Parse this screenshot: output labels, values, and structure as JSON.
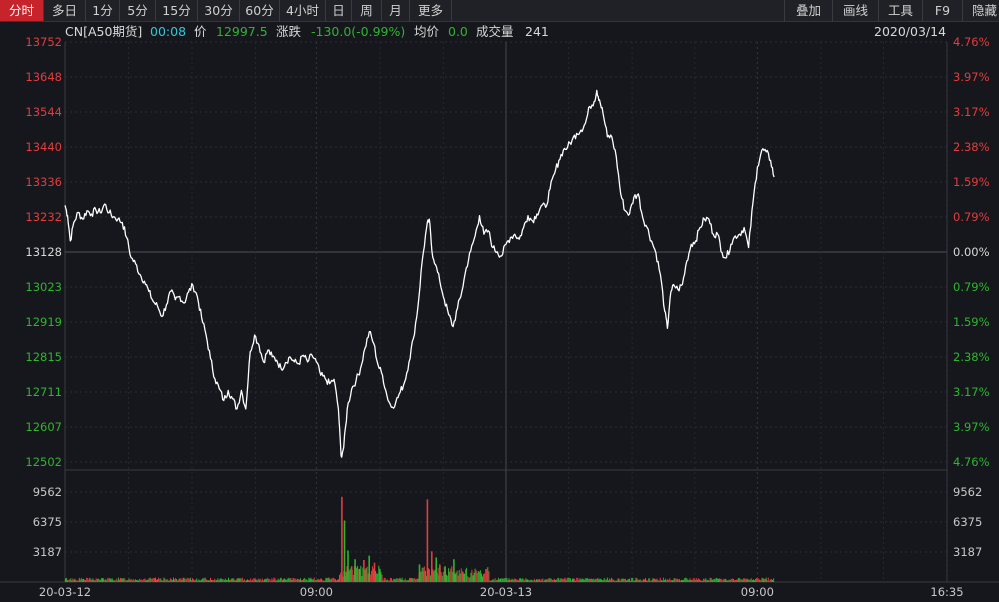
{
  "toolbar": {
    "tabs": [
      {
        "label": "分时",
        "active": true
      },
      {
        "label": "多日",
        "active": false
      },
      {
        "label": "1分",
        "active": false
      },
      {
        "label": "5分",
        "active": false
      },
      {
        "label": "15分",
        "active": false
      },
      {
        "label": "30分",
        "active": false
      },
      {
        "label": "60分",
        "active": false
      },
      {
        "label": "4小时",
        "active": false
      },
      {
        "label": "日",
        "active": false
      },
      {
        "label": "周",
        "active": false
      },
      {
        "label": "月",
        "active": false
      },
      {
        "label": "更多",
        "active": false
      }
    ],
    "right": [
      "叠加",
      "画线",
      "工具",
      "F9",
      "隐藏"
    ]
  },
  "info": {
    "symbol": "CN[A50期货]",
    "time": "00:08",
    "price_label": "价",
    "price": "12997.5",
    "change_label": "涨跌",
    "change": "-130.0(-0.99%)",
    "avg_label": "均价",
    "avg": "0.0",
    "volume_label": "成交量",
    "volume": "241",
    "date": "2020/03/14"
  },
  "colors": {
    "up": "#e23c3c",
    "down": "#2fb42f",
    "line": "#ffffff",
    "grid": "#2c2d33",
    "neutral": "#d8d8d8",
    "cyan": "#30c8d8"
  },
  "chart_data": {
    "type": "line",
    "y_ticks": [
      13752,
      13648,
      13544,
      13440,
      13336,
      13232,
      13128,
      13023,
      12919,
      12815,
      12711,
      12607,
      12502
    ],
    "pct_ticks": [
      "4.76%",
      "3.97%",
      "3.17%",
      "2.38%",
      "1.59%",
      "0.79%",
      "0.00%",
      "0.79%",
      "1.59%",
      "2.38%",
      "3.17%",
      "3.97%",
      "4.76%"
    ],
    "base_price": 13128,
    "ylim": [
      12502,
      13752
    ],
    "x_labels": [
      "20-03-12",
      "09:00",
      "20-03-13",
      "09:00",
      "16:35"
    ],
    "x_domain": [
      0,
      100
    ],
    "x_label_positions": [
      0,
      28.5,
      50,
      78.5,
      100
    ],
    "price_series": [
      [
        0,
        13266
      ],
      [
        0.3,
        13235
      ],
      [
        0.6,
        13160
      ],
      [
        1.0,
        13215
      ],
      [
        1.5,
        13245
      ],
      [
        2.0,
        13225
      ],
      [
        2.5,
        13250
      ],
      [
        3.0,
        13240
      ],
      [
        3.5,
        13252
      ],
      [
        4.0,
        13244
      ],
      [
        4.5,
        13270
      ],
      [
        5.0,
        13244
      ],
      [
        5.5,
        13232
      ],
      [
        6.0,
        13225
      ],
      [
        6.5,
        13215
      ],
      [
        7.0,
        13170
      ],
      [
        7.5,
        13110
      ],
      [
        8.0,
        13092
      ],
      [
        8.5,
        13060
      ],
      [
        9.0,
        13040
      ],
      [
        9.5,
        13010
      ],
      [
        10.0,
        12980
      ],
      [
        10.5,
        12965
      ],
      [
        11.0,
        12935
      ],
      [
        11.5,
        12970
      ],
      [
        12.0,
        13010
      ],
      [
        12.5,
        12985
      ],
      [
        13.0,
        12995
      ],
      [
        13.5,
        12975
      ],
      [
        14.0,
        13008
      ],
      [
        14.5,
        13028
      ],
      [
        15.0,
        12995
      ],
      [
        15.5,
        12930
      ],
      [
        16.0,
        12880
      ],
      [
        16.5,
        12810
      ],
      [
        17.0,
        12750
      ],
      [
        17.5,
        12720
      ],
      [
        18.0,
        12685
      ],
      [
        18.5,
        12715
      ],
      [
        19.0,
        12690
      ],
      [
        19.5,
        12660
      ],
      [
        20.0,
        12715
      ],
      [
        20.5,
        12660
      ],
      [
        21.0,
        12830
      ],
      [
        21.5,
        12880
      ],
      [
        22.0,
        12850
      ],
      [
        22.5,
        12800
      ],
      [
        23.0,
        12835
      ],
      [
        23.5,
        12815
      ],
      [
        24.0,
        12805
      ],
      [
        24.5,
        12780
      ],
      [
        25.0,
        12798
      ],
      [
        25.5,
        12815
      ],
      [
        26.0,
        12800
      ],
      [
        26.5,
        12795
      ],
      [
        27.0,
        12820
      ],
      [
        27.5,
        12800
      ],
      [
        28.0,
        12820
      ],
      [
        28.5,
        12800
      ],
      [
        29.0,
        12760
      ],
      [
        29.5,
        12750
      ],
      [
        30.0,
        12735
      ],
      [
        30.5,
        12748
      ],
      [
        31.0,
        12660
      ],
      [
        31.3,
        12520
      ],
      [
        31.6,
        12545
      ],
      [
        32.0,
        12660
      ],
      [
        32.5,
        12720
      ],
      [
        33.0,
        12745
      ],
      [
        33.5,
        12780
      ],
      [
        34.0,
        12840
      ],
      [
        34.5,
        12890
      ],
      [
        35.0,
        12855
      ],
      [
        35.5,
        12790
      ],
      [
        36.0,
        12760
      ],
      [
        36.5,
        12700
      ],
      [
        37.0,
        12665
      ],
      [
        37.5,
        12680
      ],
      [
        38.0,
        12710
      ],
      [
        38.5,
        12740
      ],
      [
        39.0,
        12800
      ],
      [
        39.5,
        12870
      ],
      [
        40.0,
        12960
      ],
      [
        40.5,
        13100
      ],
      [
        41.0,
        13200
      ],
      [
        41.3,
        13225
      ],
      [
        41.6,
        13130
      ],
      [
        42.0,
        13090
      ],
      [
        42.5,
        13040
      ],
      [
        43.0,
        12985
      ],
      [
        43.5,
        12940
      ],
      [
        44.0,
        12905
      ],
      [
        44.5,
        12960
      ],
      [
        45.0,
        13010
      ],
      [
        45.5,
        13080
      ],
      [
        46.0,
        13130
      ],
      [
        46.5,
        13175
      ],
      [
        47.0,
        13235
      ],
      [
        47.5,
        13180
      ],
      [
        48.0,
        13190
      ],
      [
        48.5,
        13140
      ],
      [
        49.0,
        13128
      ],
      [
        49.5,
        13115
      ],
      [
        50.0,
        13150
      ],
      [
        50.5,
        13170
      ],
      [
        51.0,
        13180
      ],
      [
        51.5,
        13165
      ],
      [
        52.0,
        13200
      ],
      [
        52.5,
        13235
      ],
      [
        53.0,
        13220
      ],
      [
        53.5,
        13240
      ],
      [
        54.0,
        13265
      ],
      [
        54.5,
        13260
      ],
      [
        55.0,
        13315
      ],
      [
        55.5,
        13360
      ],
      [
        56.0,
        13400
      ],
      [
        56.5,
        13430
      ],
      [
        57.0,
        13440
      ],
      [
        57.5,
        13460
      ],
      [
        58.0,
        13480
      ],
      [
        58.5,
        13490
      ],
      [
        59.0,
        13510
      ],
      [
        59.5,
        13560
      ],
      [
        60.0,
        13575
      ],
      [
        60.3,
        13608
      ],
      [
        60.6,
        13580
      ],
      [
        61.0,
        13540
      ],
      [
        61.5,
        13470
      ],
      [
        62.0,
        13470
      ],
      [
        62.5,
        13410
      ],
      [
        63.0,
        13300
      ],
      [
        63.5,
        13250
      ],
      [
        64.0,
        13240
      ],
      [
        64.5,
        13290
      ],
      [
        65.0,
        13300
      ],
      [
        65.5,
        13230
      ],
      [
        66.0,
        13200
      ],
      [
        66.5,
        13160
      ],
      [
        67.0,
        13125
      ],
      [
        67.5,
        13060
      ],
      [
        68.0,
        12950
      ],
      [
        68.3,
        12900
      ],
      [
        68.6,
        12990
      ],
      [
        69.0,
        13030
      ],
      [
        69.5,
        13015
      ],
      [
        70.0,
        13030
      ],
      [
        70.5,
        13100
      ],
      [
        71.0,
        13150
      ],
      [
        71.5,
        13160
      ],
      [
        72.0,
        13200
      ],
      [
        72.5,
        13225
      ],
      [
        73.0,
        13225
      ],
      [
        73.5,
        13180
      ],
      [
        74.0,
        13180
      ],
      [
        74.5,
        13125
      ],
      [
        75.0,
        13110
      ],
      [
        75.5,
        13150
      ],
      [
        76.0,
        13175
      ],
      [
        76.5,
        13180
      ],
      [
        77.0,
        13200
      ],
      [
        77.5,
        13140
      ],
      [
        78.0,
        13275
      ],
      [
        78.5,
        13380
      ],
      [
        79.0,
        13430
      ],
      [
        79.5,
        13425
      ],
      [
        80.0,
        13400
      ],
      [
        80.4,
        13350
      ]
    ],
    "volume_ticks": [
      9562,
      6375,
      3187
    ],
    "volume_ylim": [
      0,
      12750
    ],
    "volume_events": [
      {
        "x": 31.3,
        "v": 9700,
        "dir": "up"
      },
      {
        "x": 31.6,
        "v": 7000,
        "dir": "down"
      },
      {
        "x": 32.0,
        "v": 3600,
        "dir": "down"
      },
      {
        "x": 32.4,
        "v": 1800,
        "dir": "up"
      },
      {
        "x": 32.8,
        "v": 2600,
        "dir": "down"
      },
      {
        "x": 33.3,
        "v": 1500,
        "dir": "down"
      },
      {
        "x": 33.8,
        "v": 2500,
        "dir": "up"
      },
      {
        "x": 34.4,
        "v": 3000,
        "dir": "down"
      },
      {
        "x": 35.0,
        "v": 2200,
        "dir": "up"
      },
      {
        "x": 35.6,
        "v": 1500,
        "dir": "down"
      },
      {
        "x": 40.1,
        "v": 2000,
        "dir": "down"
      },
      {
        "x": 40.6,
        "v": 1200,
        "dir": "up"
      },
      {
        "x": 41.0,
        "v": 9400,
        "dir": "up"
      },
      {
        "x": 41.5,
        "v": 3500,
        "dir": "up"
      },
      {
        "x": 42.0,
        "v": 2800,
        "dir": "down"
      },
      {
        "x": 42.4,
        "v": 2000,
        "dir": "up"
      },
      {
        "x": 43.0,
        "v": 1800,
        "dir": "down"
      },
      {
        "x": 44.0,
        "v": 2600,
        "dir": "down"
      },
      {
        "x": 45.0,
        "v": 1200,
        "dir": "up"
      }
    ]
  }
}
